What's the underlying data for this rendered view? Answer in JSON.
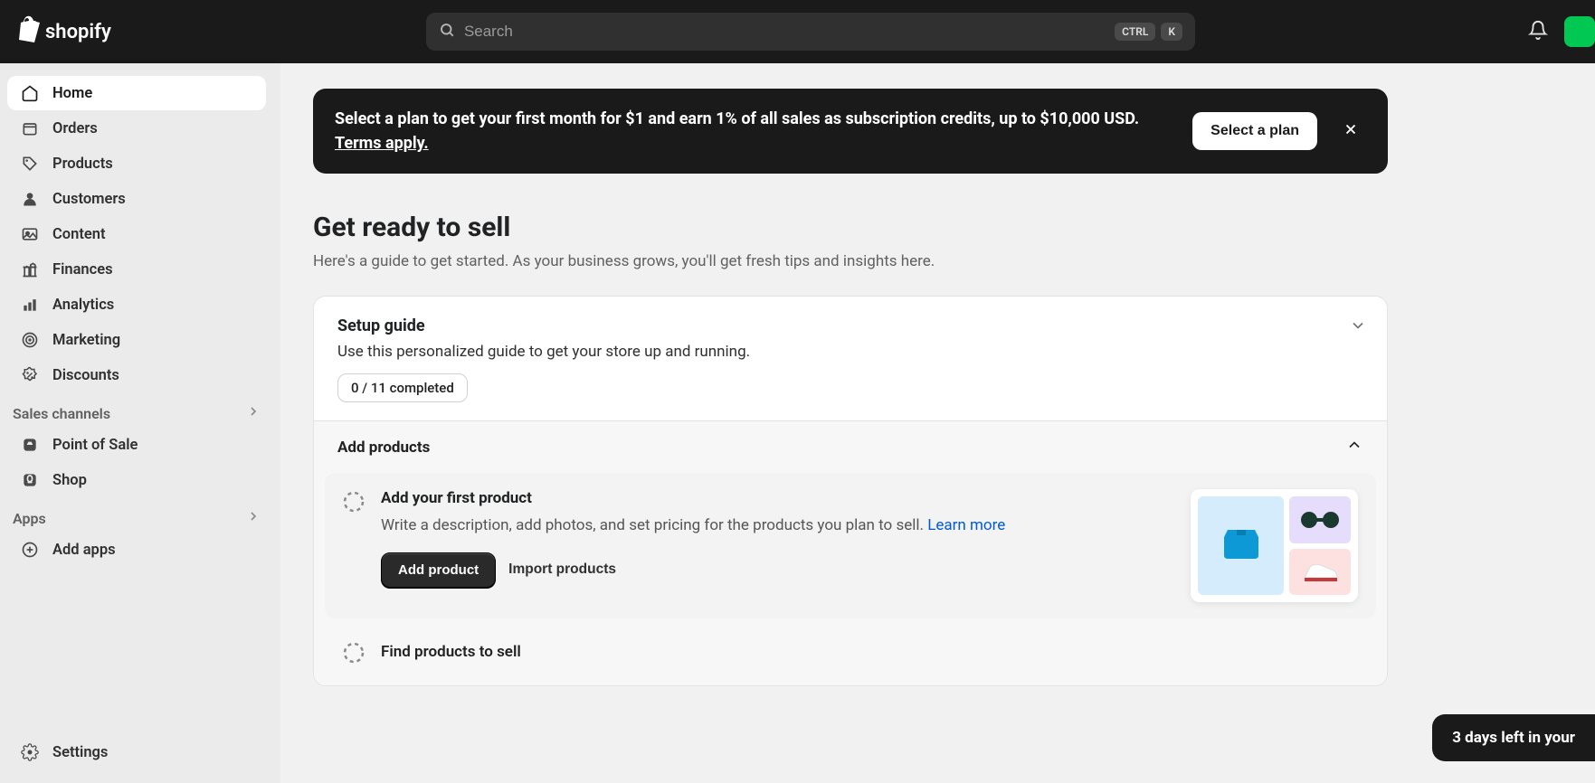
{
  "header": {
    "brand": "shopify",
    "search_placeholder": "Search",
    "kbd1": "CTRL",
    "kbd2": "K"
  },
  "sidebar": {
    "items": [
      {
        "label": "Home",
        "icon": "home",
        "active": true
      },
      {
        "label": "Orders",
        "icon": "orders"
      },
      {
        "label": "Products",
        "icon": "products"
      },
      {
        "label": "Customers",
        "icon": "customers"
      },
      {
        "label": "Content",
        "icon": "content"
      },
      {
        "label": "Finances",
        "icon": "finances"
      },
      {
        "label": "Analytics",
        "icon": "analytics"
      },
      {
        "label": "Marketing",
        "icon": "marketing"
      },
      {
        "label": "Discounts",
        "icon": "discounts"
      }
    ],
    "sales_channels_label": "Sales channels",
    "channels": [
      {
        "label": "Point of Sale",
        "icon": "pos"
      },
      {
        "label": "Shop",
        "icon": "shop"
      }
    ],
    "apps_label": "Apps",
    "add_apps_label": "Add apps",
    "settings_label": "Settings"
  },
  "banner": {
    "text": "Select a plan to get your first month for $1 and earn 1% of all sales as subscription credits, up to $10,000 USD. ",
    "terms": "Terms apply.",
    "button": "Select a plan"
  },
  "hero": {
    "title": "Get ready to sell",
    "subtitle": "Here's a guide to get started. As your business grows, you'll get fresh tips and insights here."
  },
  "setup": {
    "title": "Setup guide",
    "subtitle": "Use this personalized guide to get your store up and running.",
    "progress": "0 / 11 completed",
    "section_title": "Add products",
    "task1": {
      "title": "Add your first product",
      "desc": "Write a description, add photos, and set pricing for the products you plan to sell. ",
      "learn": "Learn more",
      "primary": "Add product",
      "secondary": "Import products"
    },
    "task2": {
      "title": "Find products to sell"
    }
  },
  "trial": {
    "text": "3 days left in your"
  }
}
